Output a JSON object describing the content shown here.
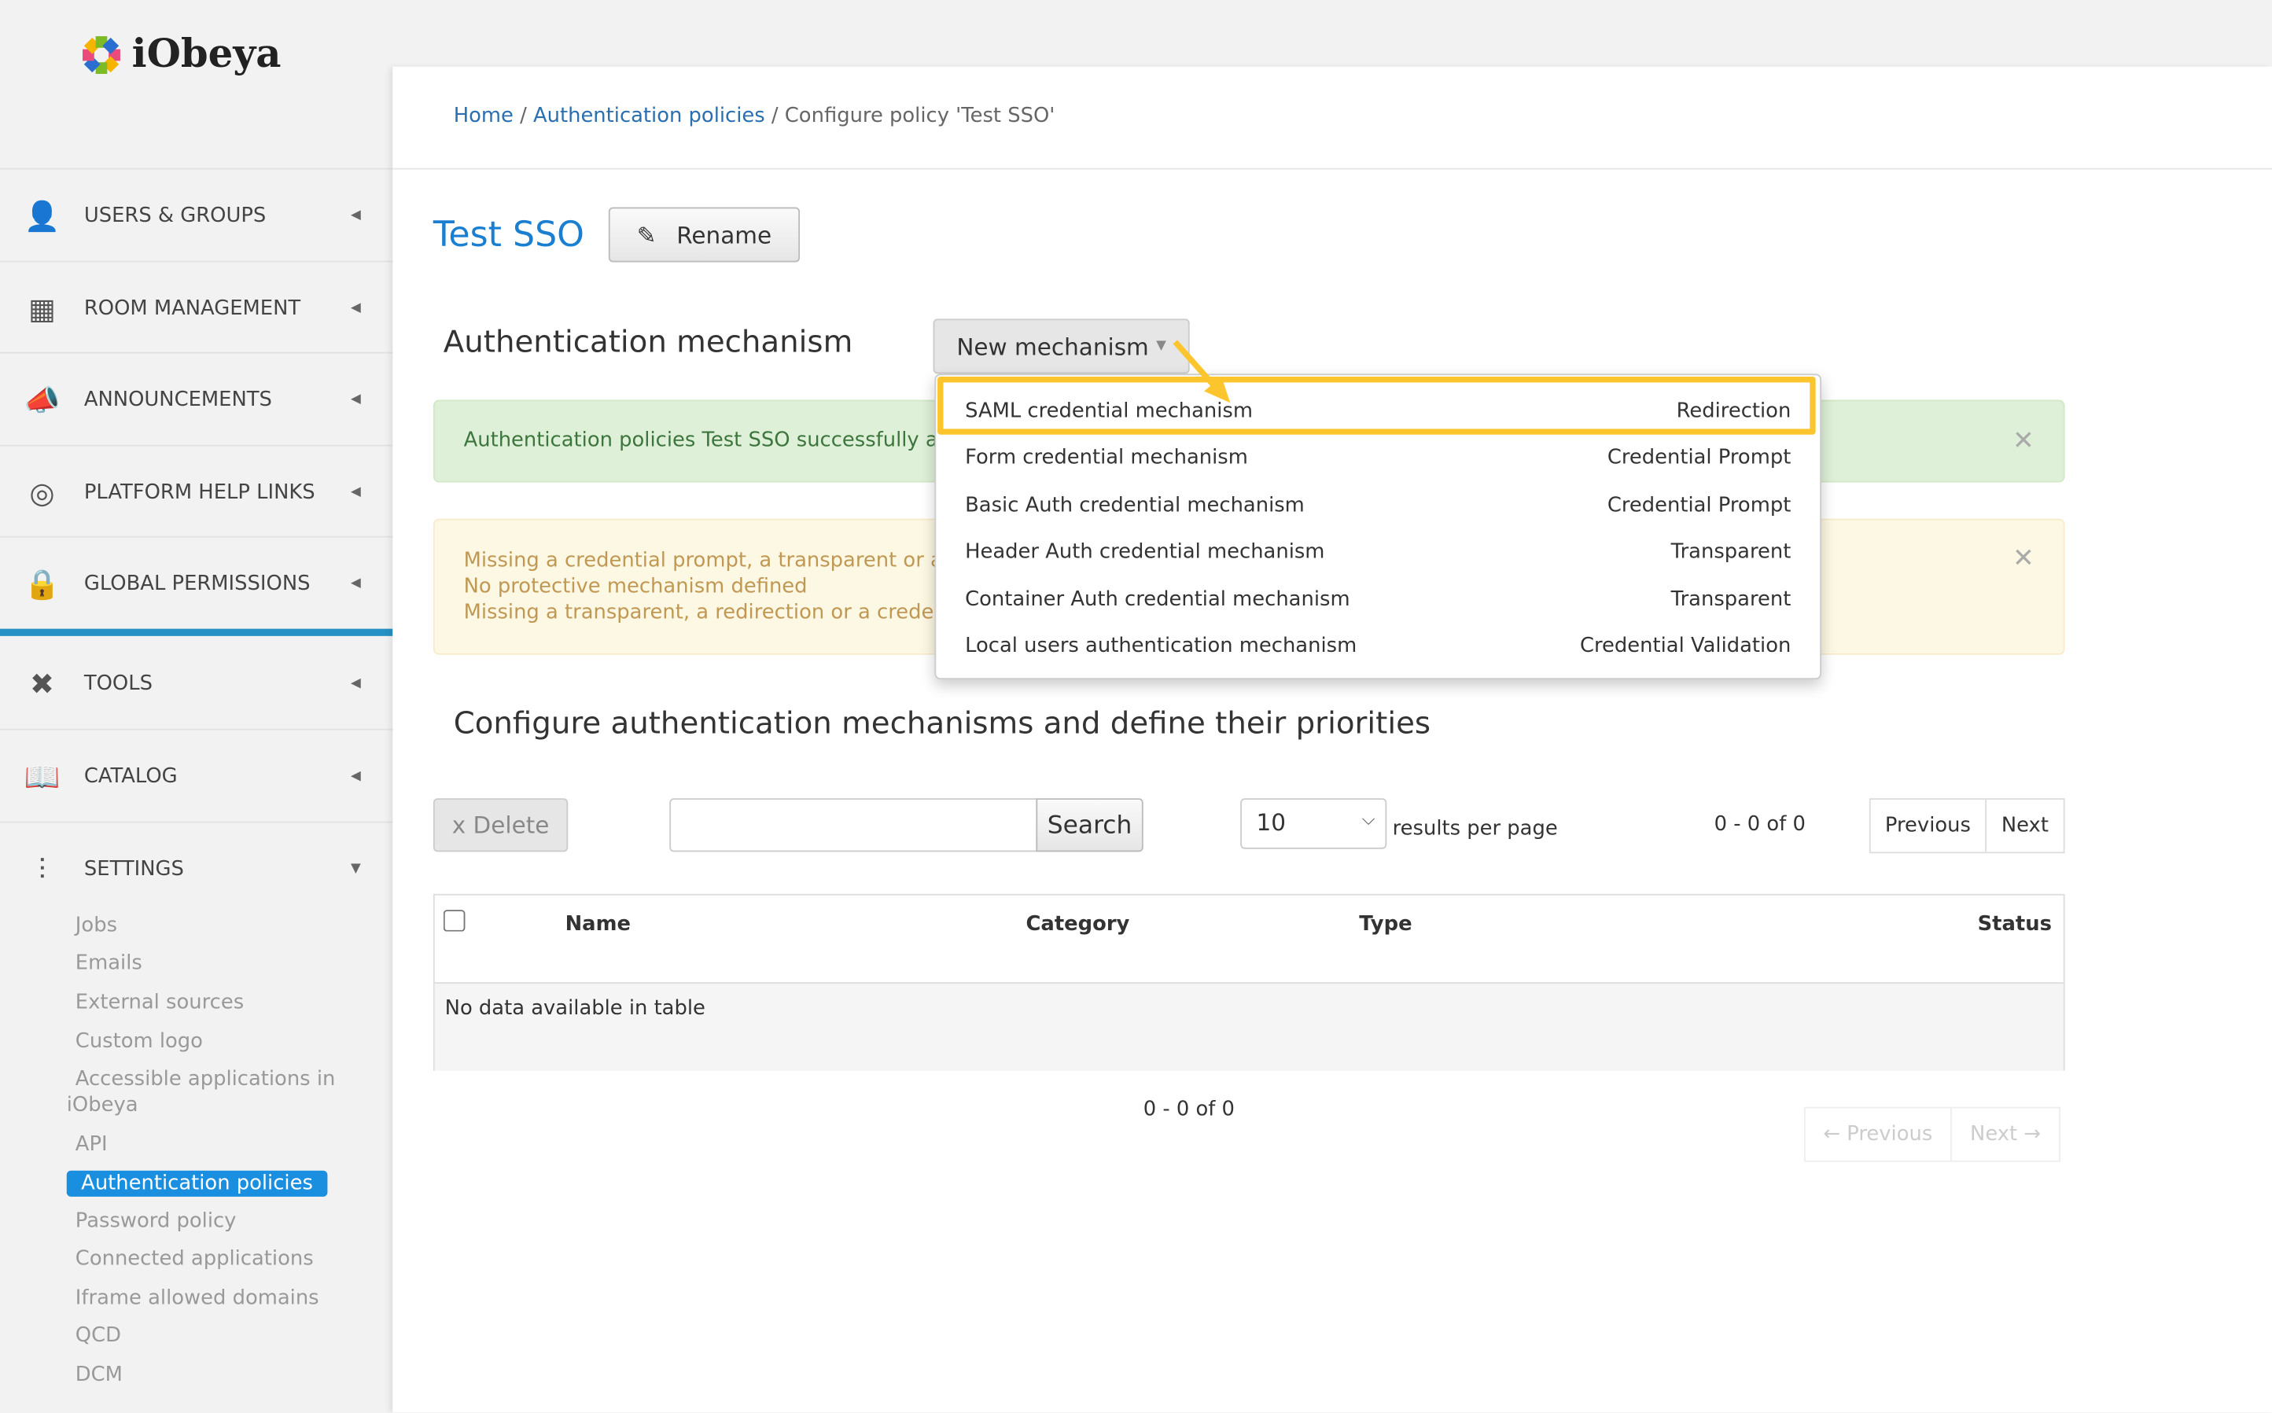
{
  "logo": {
    "text": "iObeya"
  },
  "sidebar": {
    "items": [
      {
        "label": "USERS & GROUPS",
        "icon": "user-icon"
      },
      {
        "label": "ROOM MANAGEMENT",
        "icon": "building-icon"
      },
      {
        "label": "ANNOUNCEMENTS",
        "icon": "megaphone-icon"
      },
      {
        "label": "PLATFORM HELP LINKS",
        "icon": "lifebuoy-icon"
      },
      {
        "label": "GLOBAL PERMISSIONS",
        "icon": "lock-icon"
      },
      {
        "label": "TOOLS",
        "icon": "tools-icon"
      },
      {
        "label": "CATALOG",
        "icon": "catalog-icon"
      },
      {
        "label": "SETTINGS",
        "icon": "sliders-icon"
      }
    ],
    "settings_sub": [
      "Jobs",
      "Emails",
      "External sources",
      "Custom logo",
      "Accessible applications in",
      "iObeya",
      "API",
      "Authentication policies",
      "Password policy",
      "Connected applications",
      "Iframe allowed domains",
      "QCD",
      "DCM"
    ],
    "active_color": "#1a8fe0"
  },
  "breadcrumb": {
    "home": "Home",
    "policies": "Authentication policies",
    "current": "Configure policy 'Test SSO'"
  },
  "policy": {
    "title": "Test SSO",
    "rename": "Rename"
  },
  "mechanism": {
    "heading": "Authentication mechanism",
    "new_button": "New mechanism"
  },
  "alerts": {
    "success": "Authentication policies Test SSO successfully add",
    "warning": [
      "Missing a credential prompt, a transparent or a r",
      "No protective mechanism defined",
      "Missing a transparent, a redirection or a credenti"
    ]
  },
  "dropdown": [
    {
      "name": "SAML credential mechanism",
      "type": "Redirection"
    },
    {
      "name": "Form credential mechanism",
      "type": "Credential Prompt"
    },
    {
      "name": "Basic Auth credential mechanism",
      "type": "Credential Prompt"
    },
    {
      "name": "Header Auth credential mechanism",
      "type": "Transparent"
    },
    {
      "name": "Container Auth credential mechanism",
      "type": "Transparent"
    },
    {
      "name": "Local users authentication mechanism",
      "type": "Credential Validation"
    }
  ],
  "highlight_color": "#fcc52d",
  "configure": {
    "heading": "Configure authentication mechanisms and define their priorities",
    "delete": "x Delete",
    "search_value": "",
    "search": "Search",
    "per_page": "10",
    "per_page_label": "results per page",
    "range_top": "0 - 0 of 0",
    "previous": "Previous",
    "next": "Next",
    "columns": [
      "Name",
      "Category",
      "Type",
      "Status"
    ],
    "empty": "No data available in table",
    "range_bottom": "0 - 0 of 0",
    "prev_bottom": "← Previous",
    "next_bottom": "Next →"
  }
}
